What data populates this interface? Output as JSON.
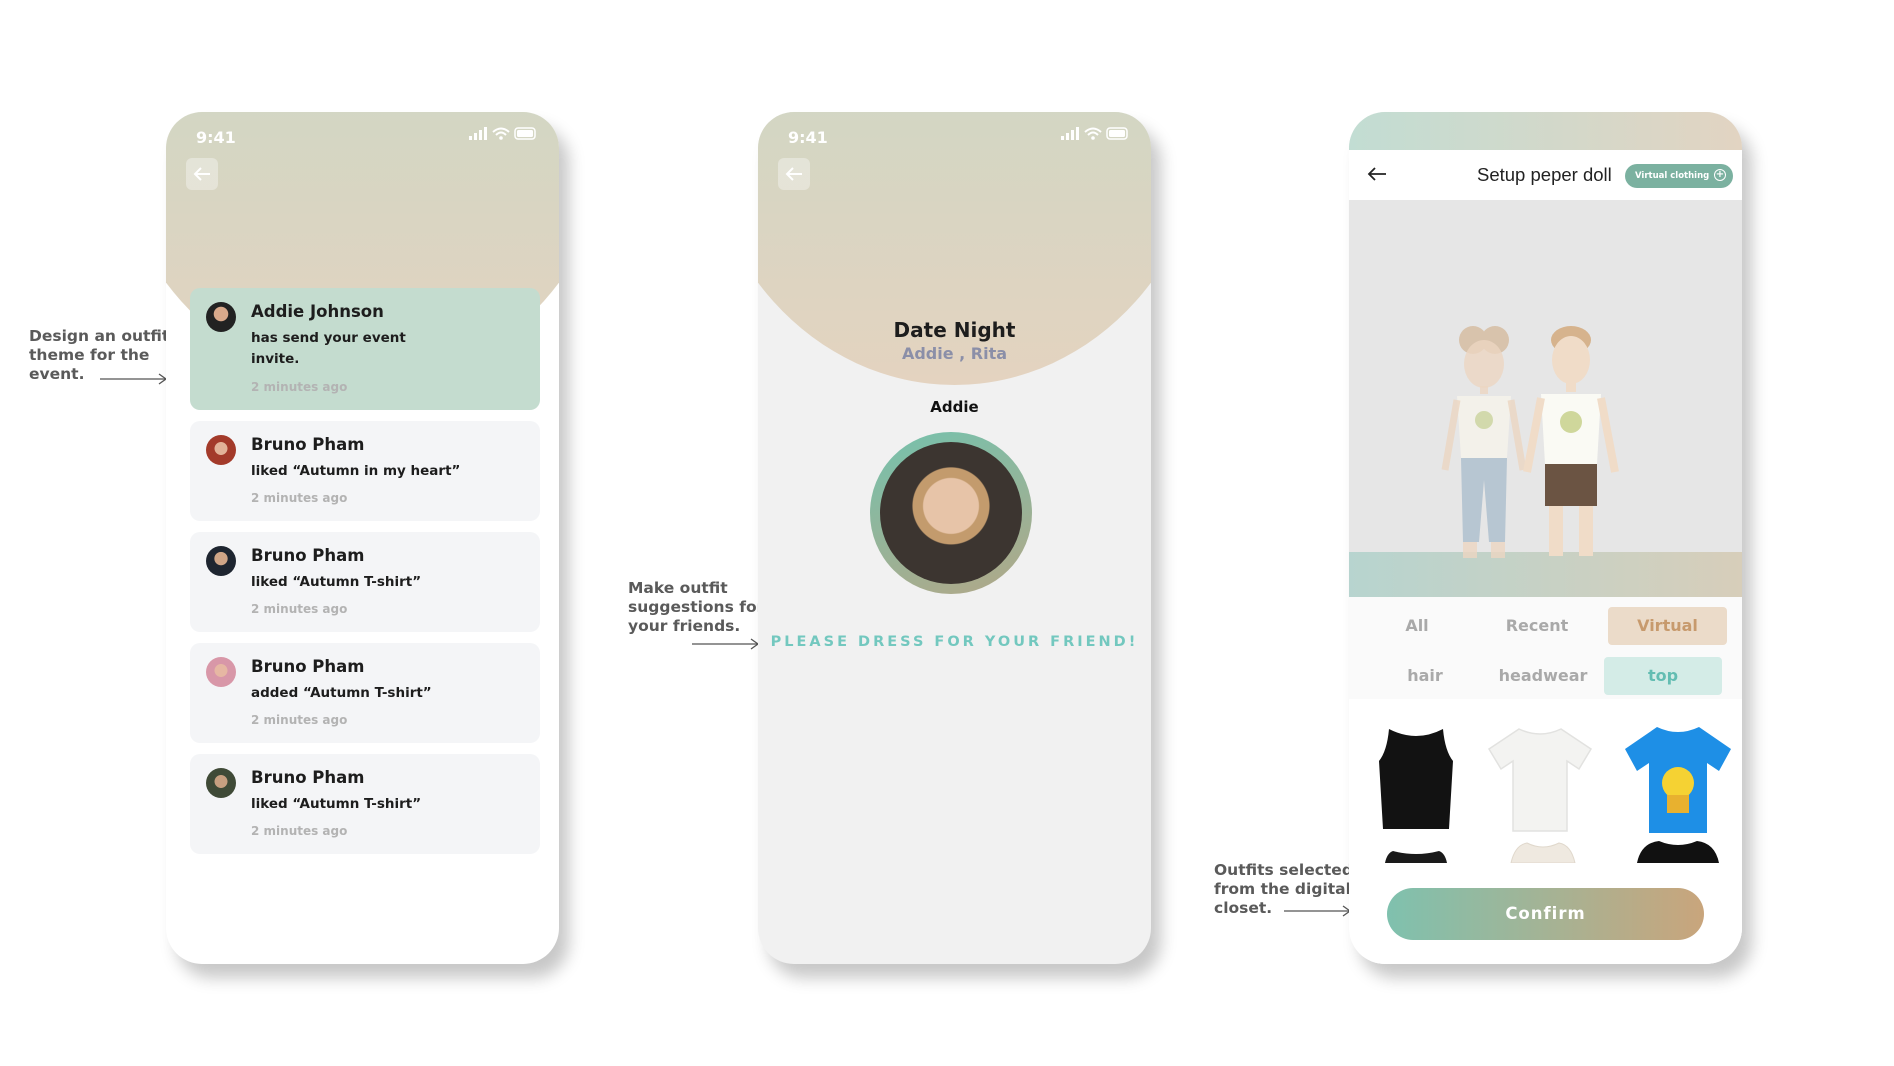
{
  "annotations": {
    "left": "Design an outfit\ntheme for the\nevent.",
    "middle": "Make outfit\nsuggestions for\nyour friends.",
    "right": "Outfits selected\nfrom the digital\ncloset."
  },
  "status_bar": {
    "time": "9:41"
  },
  "notifications": {
    "items": [
      {
        "name": "Addie Johnson",
        "message": "has send your event invite.",
        "time": "2 minutes ago"
      },
      {
        "name": "Bruno Pham",
        "message": "liked “Autumn in my heart”",
        "time": "2 minutes ago"
      },
      {
        "name": "Bruno Pham",
        "message": "liked “Autumn T-shirt”",
        "time": "2 minutes ago"
      },
      {
        "name": "Bruno Pham",
        "message": "added “Autumn T-shirt”",
        "time": "2 minutes ago"
      },
      {
        "name": "Bruno Pham",
        "message": "liked “Autumn T-shirt”",
        "time": "2 minutes ago"
      }
    ]
  },
  "event": {
    "title": "Date Night",
    "participants": "Addie , Rita",
    "friend_name": "Addie",
    "cta": "PLEASE DRESS FOR YOUR FRIEND!"
  },
  "paper_doll": {
    "title": "Setup peper doll",
    "virtual_pill": "Virtual clothing",
    "tabs": [
      "All",
      "Recent",
      "Virtual"
    ],
    "categories": [
      "hair",
      "headwear",
      "top"
    ],
    "confirm": "Confirm"
  },
  "colors": {
    "mint": "#c2ddd3",
    "sand": "#e4d3c0",
    "accent_teal": "#73c8bf",
    "accent_tan": "#c79a6d"
  }
}
